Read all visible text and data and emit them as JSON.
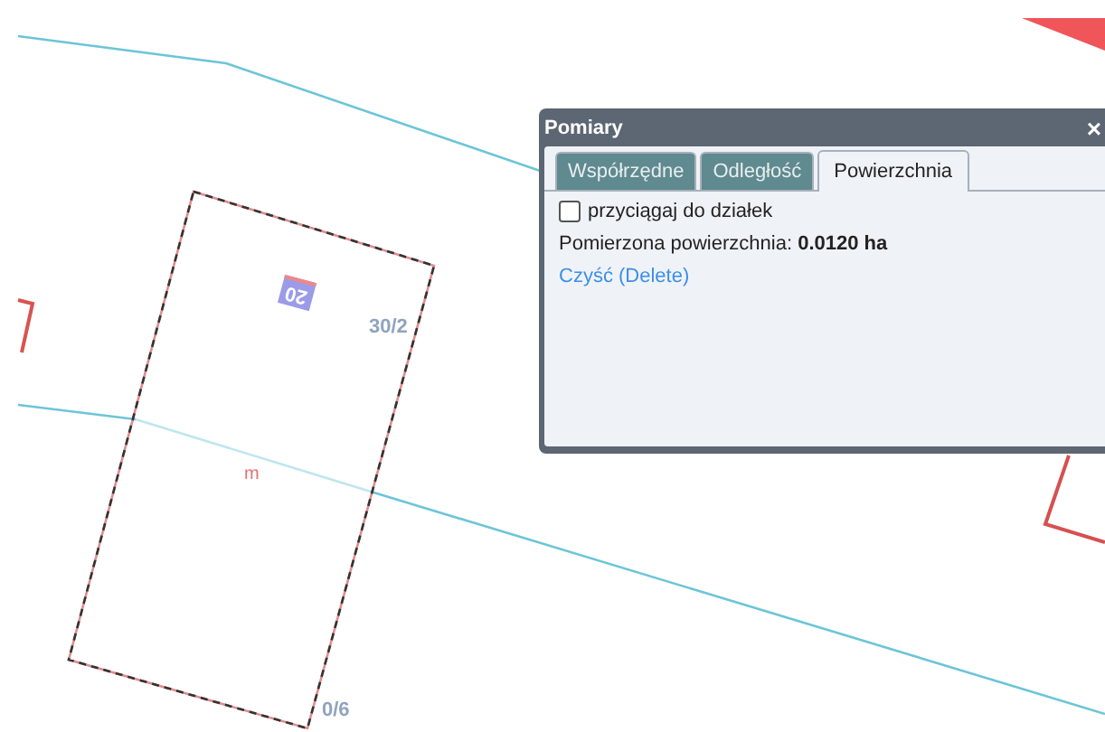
{
  "map": {
    "labels": [
      {
        "kind": "badge",
        "text": "20"
      },
      {
        "kind": "parcel",
        "text": "30/2"
      },
      {
        "kind": "measure",
        "text": "m"
      },
      {
        "kind": "parcel",
        "text": "0/6"
      }
    ]
  },
  "dialog": {
    "title": "Pomiary",
    "close": "×",
    "tabs": [
      {
        "label": "Współrzędne",
        "selected": false
      },
      {
        "label": "Odległość",
        "selected": false
      },
      {
        "label": "Powierzchnia",
        "selected": true
      }
    ],
    "snap": {
      "label": "przyciągaj do działek",
      "checked": false
    },
    "result": "Pomierzona powierzchnia: **0.0120 ha**",
    "clear_link": "Czyść (Delete)"
  }
}
